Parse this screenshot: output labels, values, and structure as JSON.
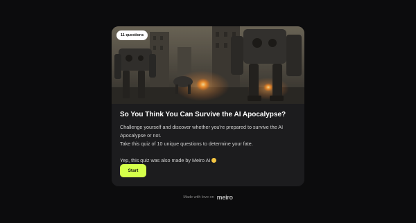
{
  "quiz": {
    "badge": "11 questions",
    "title": "So You Think You Can Survive the AI Apocalypse?",
    "description_line1": "Challenge yourself and discover whether you're prepared to survive the AI Apocalypse or not.",
    "description_line2": "Take this quiz of 10 unique questions to determine your fate.",
    "description_line3": "Yep, this quiz was also made by Meiro AI",
    "start_label": "Start"
  },
  "footer": {
    "text": "Made with love on",
    "logo": "meiro"
  },
  "colors": {
    "background": "#0c0c0d",
    "card": "#1c1c1e",
    "accent": "#d4ff4a"
  },
  "icons": {
    "emoji": "smiling-face-icon",
    "hero": "robots-apocalypse-image"
  }
}
